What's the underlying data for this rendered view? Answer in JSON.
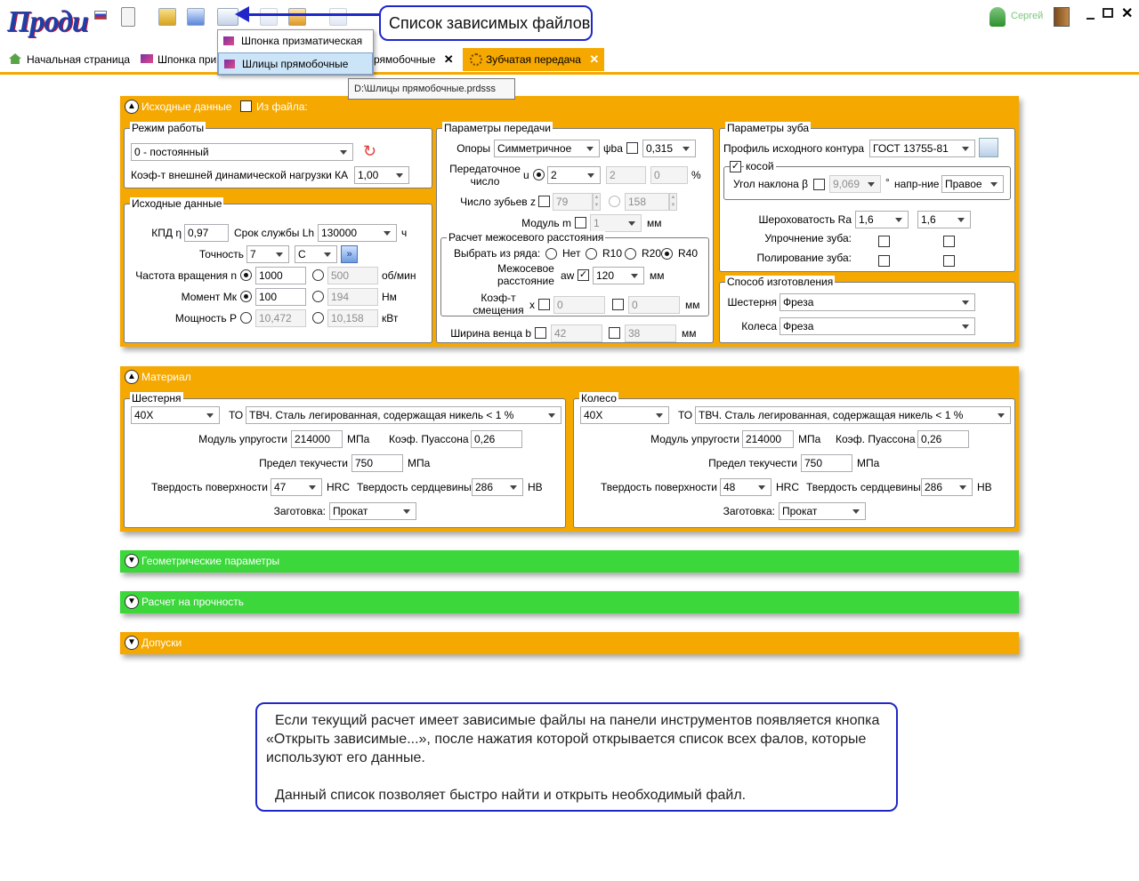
{
  "app": {
    "logo": "Проди",
    "user": "Сергей"
  },
  "callouts": {
    "dependent_files": "Список зависимых файлов",
    "explanation_p1": "Если текущий расчет имеет зависимые файлы на панели инструментов появляется кнопка «Открыть зависимые...», после нажатия которой открывается список всех фалов, которые используют его данные.",
    "explanation_p2": "Данный список позволяет быстро найти и открыть необходимый файл."
  },
  "dropdown_menu": [
    "Шпонка призматическая",
    "Шлицы прямобочные"
  ],
  "tooltip": "D:\\Шлицы прямобочные.prdsss",
  "tabs": {
    "home": "Начальная страница",
    "tab2_visible": "Шпонка при",
    "tab3_visible": "рямобочные",
    "active": "Зубчатая передача"
  },
  "sections": {
    "initial": "Исходные данные",
    "from_file": "Из файла:",
    "material": "Материал",
    "geometry": "Геометрические параметры",
    "strength": "Расчет на прочность",
    "tolerances": "Допуски"
  },
  "mode": {
    "legend": "Режим работы",
    "value": "0 - постоянный",
    "ka_label": "Коэф-т внешней динамической нагрузки КА",
    "ka_value": "1,00"
  },
  "initial": {
    "legend": "Исходные данные",
    "kpd_label": "КПД η",
    "kpd": "0,97",
    "life_label": "Срок службы Lh",
    "life": "130000",
    "life_unit": "ч",
    "acc_label": "Точность",
    "acc1": "7",
    "acc2": "C",
    "freq_label": "Частота вращения n",
    "freq1": "1000",
    "freq2": "500",
    "freq_unit": "об/мин",
    "mom_label": "Момент Мк",
    "mom1": "100",
    "mom2": "194",
    "mom_unit": "Нм",
    "pow_label": "Мощность Р",
    "pow1": "10,472",
    "pow2": "10,158",
    "pow_unit": "кВт"
  },
  "transmission": {
    "legend": "Параметры передачи",
    "supports_label": "Опоры",
    "supports": "Симметричное",
    "psi_label": "ψba",
    "psi": "0,315",
    "ratio_label": "Передаточное число",
    "u_label": "u",
    "u1": "2",
    "u2": "2",
    "u3": "0",
    "pct": "%",
    "teeth_label": "Число зубьев z",
    "z1": "79",
    "z2": "158",
    "module_label": "Модуль m",
    "module": "1",
    "module_unit": "мм",
    "center_legend": "Расчет межосевого расстояния",
    "series_label": "Выбрать из ряда:",
    "series": [
      "Нет",
      "R10",
      "R20",
      "R40"
    ],
    "aw_label": "Межосевое расстояние",
    "aw_sym": "aw",
    "aw": "120",
    "aw_unit": "мм",
    "shift_label": "Коэф-т смещения",
    "x_sym": "x",
    "x1": "0",
    "x2": "0",
    "x_unit": "мм",
    "width_label": "Ширина венца b",
    "b1": "42",
    "b2": "38",
    "b_unit": "мм"
  },
  "tooth": {
    "legend": "Параметры зуба",
    "profile_label": "Профиль исходного контура",
    "profile": "ГОСТ 13755-81",
    "helical_label": "косой",
    "angle_label": "Угол наклона β",
    "angle": "9,069",
    "deg": "°",
    "dir_label": "напр-ние",
    "dir": "Правое",
    "rough_label": "Шероховатость Ra",
    "rough1": "1,6",
    "rough2": "1,6",
    "harden_label": "Упрочнение зуба:",
    "polish_label": "Полирование зуба:"
  },
  "manufacture": {
    "legend": "Способ изготовления",
    "pinion_label": "Шестерня",
    "pinion": "Фреза",
    "wheel_label": "Колеса",
    "wheel": "Фреза"
  },
  "material": {
    "labels": {
      "to": "ТО",
      "modulus": "Модуль упругости",
      "mpa": "МПа",
      "poisson": "Коэф. Пуассона",
      "yield": "Предел текучести",
      "hard_surf": "Твердость поверхности",
      "hrc": "HRC",
      "hard_core": "Твердость сердцевины",
      "hb": "НВ",
      "blank": "Заготовка:"
    },
    "pinion": {
      "legend": "Шестерня",
      "steel": "40Х",
      "to": "ТВЧ. Сталь легированная, содержащая никель < 1 %",
      "modulus": "214000",
      "poisson": "0,26",
      "yield": "750",
      "hrc": "47",
      "hb": "286",
      "blank": "Прокат"
    },
    "wheel": {
      "legend": "Колесо",
      "steel": "40Х",
      "to": "ТВЧ. Сталь легированная, содержащая никель < 1 %",
      "modulus": "214000",
      "poisson": "0,26",
      "yield": "750",
      "hrc": "48",
      "hb": "286",
      "blank": "Прокат"
    }
  }
}
